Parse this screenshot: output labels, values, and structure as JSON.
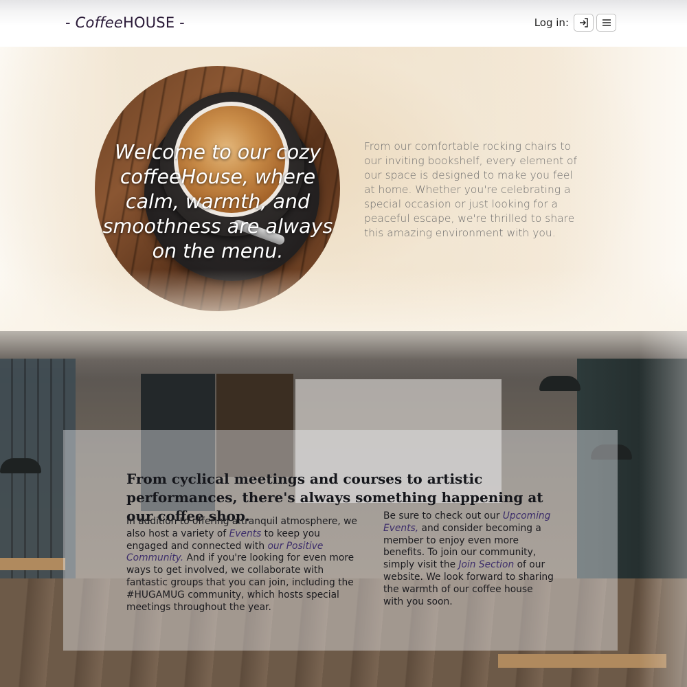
{
  "header": {
    "brand_prefix": "- ",
    "brand_italic": "Coffee",
    "brand_rest": "HOUSE",
    "brand_suffix": " -",
    "login_label": "Log in:",
    "login_icon": "login-arrow-icon",
    "menu_icon": "hamburger-menu-icon"
  },
  "hero": {
    "quote": "Welcome to our cozy coffeeHouse, where calm, warmth, and smoothness are always on the menu.",
    "description": "From our comfortable rocking chairs to our inviting bookshelf, every element of our space is designed to make you feel at home. Whether you're celebrating a special occasion or just looking for a peaceful escape, we're thrilled to share this amazing environment with you."
  },
  "info": {
    "heading": "From cyclical meetings and courses to artistic performances, there's always something happening at our coffee shop.",
    "left": {
      "t1": "In addition to offering a tranquil atmosphere, we also host a variety of ",
      "link_events": "Events",
      "t2": " to keep you engaged and connected with ",
      "link_community": "our Positive Community.",
      "t3": " And if you're looking for even more ways to get involved, we collaborate with fantastic groups that you can join, including the #HUGAMUG community, which hosts special meetings throughout the year."
    },
    "right": {
      "t1": "Be sure to check out our ",
      "link_upcoming": "Upcoming Events,",
      "t2": " and consider becoming a member to enjoy even more benefits. To join our community, simply visit the ",
      "link_join": "Join Section",
      "t3": " of our website. We look forward to sharing the warmth of our coffee house with you soon."
    }
  }
}
